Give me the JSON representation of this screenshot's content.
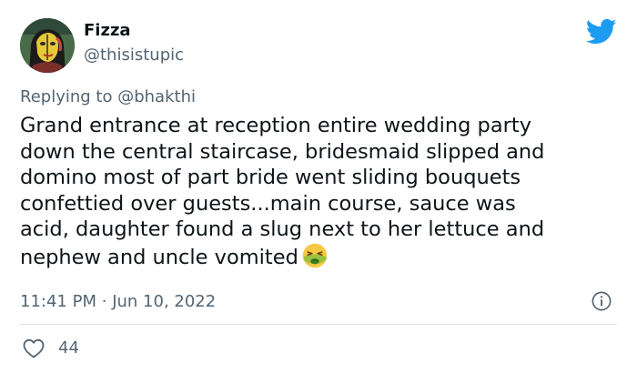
{
  "author": {
    "display_name": "Fizza",
    "handle": "@thisistupic"
  },
  "reply_context": {
    "prefix": "Replying to",
    "mention": "@bhakthi"
  },
  "tweet": {
    "lines": [
      "Grand entrance at reception entire wedding party",
      "down the central staircase, bridesmaid slipped and",
      "domino most of part bride went sliding bouquets",
      "confettied over guests...main course, sauce was",
      "acid, daughter found a slug next to her lettuce and",
      "nephew and uncle vomited"
    ],
    "emoji": "nauseated-face-emoji"
  },
  "meta": {
    "time": "11:41 PM",
    "separator": "·",
    "date": "Jun 10, 2022"
  },
  "engagement": {
    "likes": "44"
  },
  "icons": {
    "brand": "twitter-bird-icon",
    "info": "info-icon",
    "like": "heart-icon"
  },
  "colors": {
    "brand_blue": "#1d9bf0",
    "text_primary": "#0f1419",
    "text_secondary": "#536471",
    "divider": "#dfe3e7"
  }
}
